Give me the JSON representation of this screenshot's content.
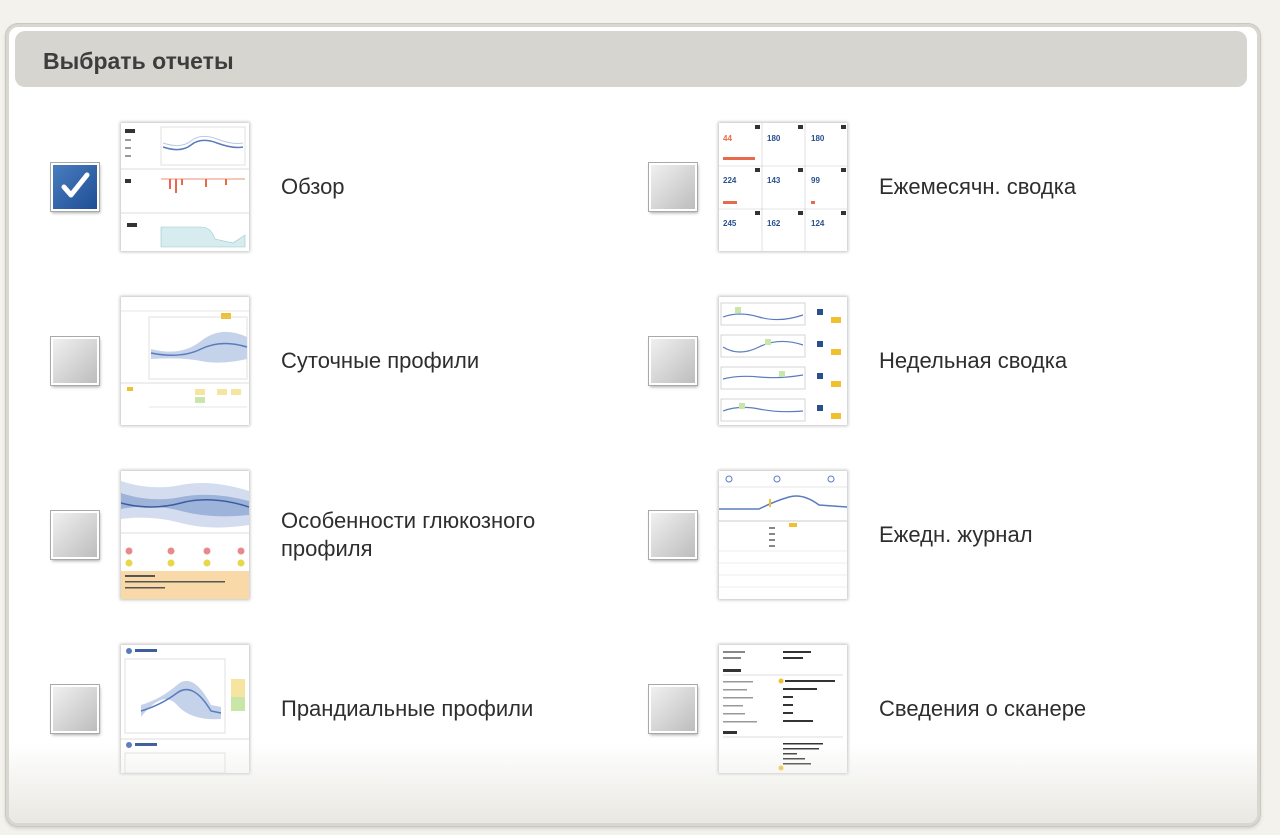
{
  "header": {
    "title": "Выбрать отчеты"
  },
  "colors": {
    "checkbox_checked": "#2a5ea8",
    "header_bg": "#d6d5cf",
    "glucose_line": "#5b7bbf",
    "low_marker": "#e86a4a"
  },
  "reports": [
    {
      "id": "overview",
      "label": "Обзор",
      "checked": true,
      "thumbnail": "overview-thumbnail"
    },
    {
      "id": "monthly",
      "label": "Ежемесячн. сводка",
      "checked": false,
      "thumbnail": "monthly-summary-thumbnail"
    },
    {
      "id": "daily-profiles",
      "label": "Суточные профили",
      "checked": false,
      "thumbnail": "daily-profiles-thumbnail"
    },
    {
      "id": "weekly",
      "label": "Недельная сводка",
      "checked": false,
      "thumbnail": "weekly-summary-thumbnail"
    },
    {
      "id": "glucose-patterns",
      "label": "Особенности глюкозного профиля",
      "checked": false,
      "thumbnail": "glucose-patterns-thumbnail"
    },
    {
      "id": "daily-log",
      "label": "Ежедн. журнал",
      "checked": false,
      "thumbnail": "daily-log-thumbnail"
    },
    {
      "id": "meal-patterns",
      "label": "Прандиальные профили",
      "checked": false,
      "thumbnail": "meal-patterns-thumbnail"
    },
    {
      "id": "reader-settings",
      "label": "Сведения о сканере",
      "checked": false,
      "thumbnail": "reader-settings-thumbnail"
    }
  ],
  "thumbnails": {
    "monthly_values": [
      "44",
      "180",
      "180",
      "224",
      "143",
      "99",
      "245",
      "162",
      "124"
    ]
  }
}
